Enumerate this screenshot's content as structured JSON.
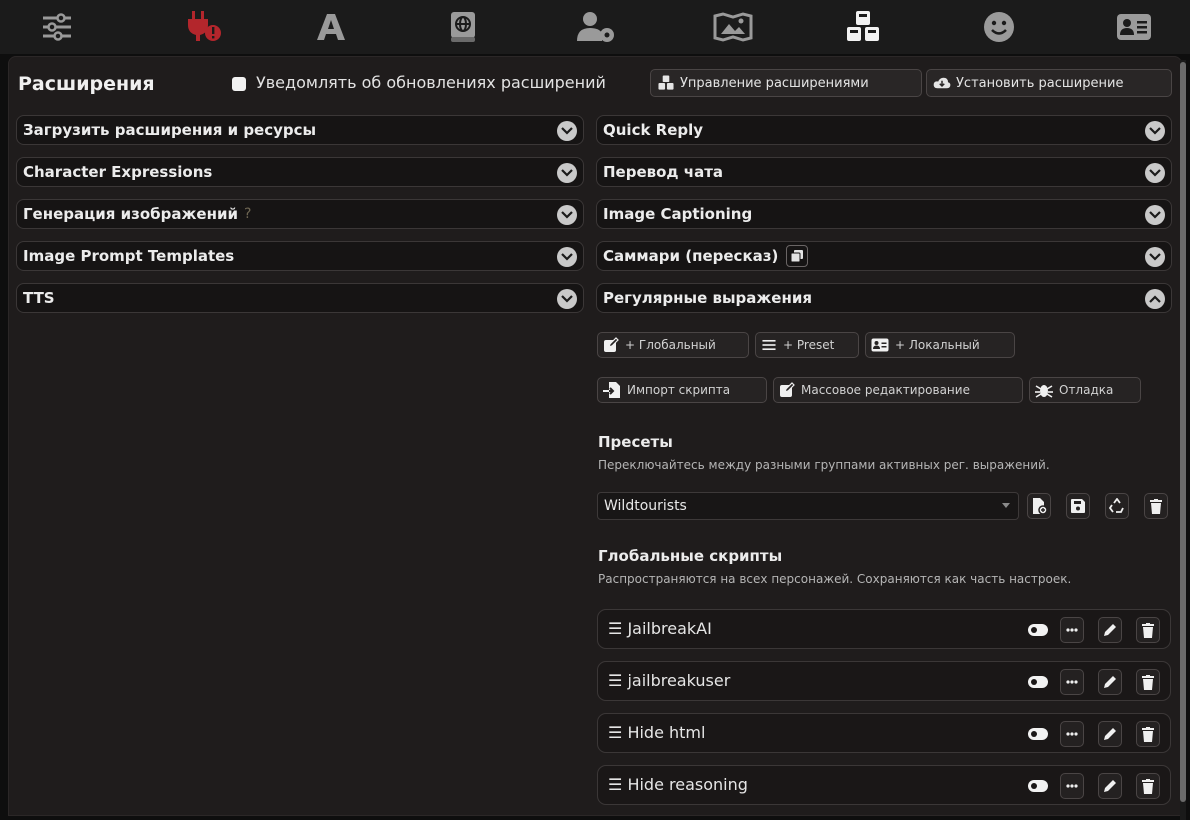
{
  "header": {
    "title": "Расширения",
    "notify_label": "Уведомлять об обновлениях расширений",
    "manage_button": "Управление расширениями",
    "install_button": "Установить расширение"
  },
  "left_drawers": [
    {
      "label": "Загрузить расширения и ресурсы"
    },
    {
      "label": "Character Expressions"
    },
    {
      "label": "Генерация изображений",
      "hint": "?"
    },
    {
      "label": "Image Prompt Templates"
    },
    {
      "label": "TTS"
    }
  ],
  "right_drawers": [
    {
      "label": "Quick Reply"
    },
    {
      "label": "Перевод чата"
    },
    {
      "label": "Image Captioning"
    },
    {
      "label": "Саммари (пересказ)"
    },
    {
      "label": "Регулярные выражения",
      "expanded": true
    }
  ],
  "regex": {
    "add_global": "+ Глобальный",
    "add_preset": "+ Preset",
    "add_local": "+ Локальный",
    "import_script": "Импорт скрипта",
    "bulk_edit": "Массовое редактирование",
    "debug": "Отладка",
    "presets_title": "Пресеты",
    "presets_desc": "Переключайтесь между разными группами активных рег. выражений.",
    "preset_selected": "Wildtourists",
    "global_title": "Глобальные скрипты",
    "global_desc": "Распространяются на всех персонажей. Сохраняются как часть настроек.",
    "scripts": [
      {
        "name": "JailbreakAI"
      },
      {
        "name": "jailbreakuser"
      },
      {
        "name": "Hide html"
      },
      {
        "name": "Hide reasoning"
      }
    ]
  },
  "colors": {
    "accent_active": "#b3262c",
    "background": "#1f1c1c",
    "topbar": "#1b1b1b"
  },
  "top_icons": [
    "sliders-icon",
    "plug-icon",
    "font-icon",
    "book-globe-icon",
    "user-gear-icon",
    "landscape-image-icon",
    "cubes-icon",
    "smiley-icon",
    "id-card-icon"
  ]
}
